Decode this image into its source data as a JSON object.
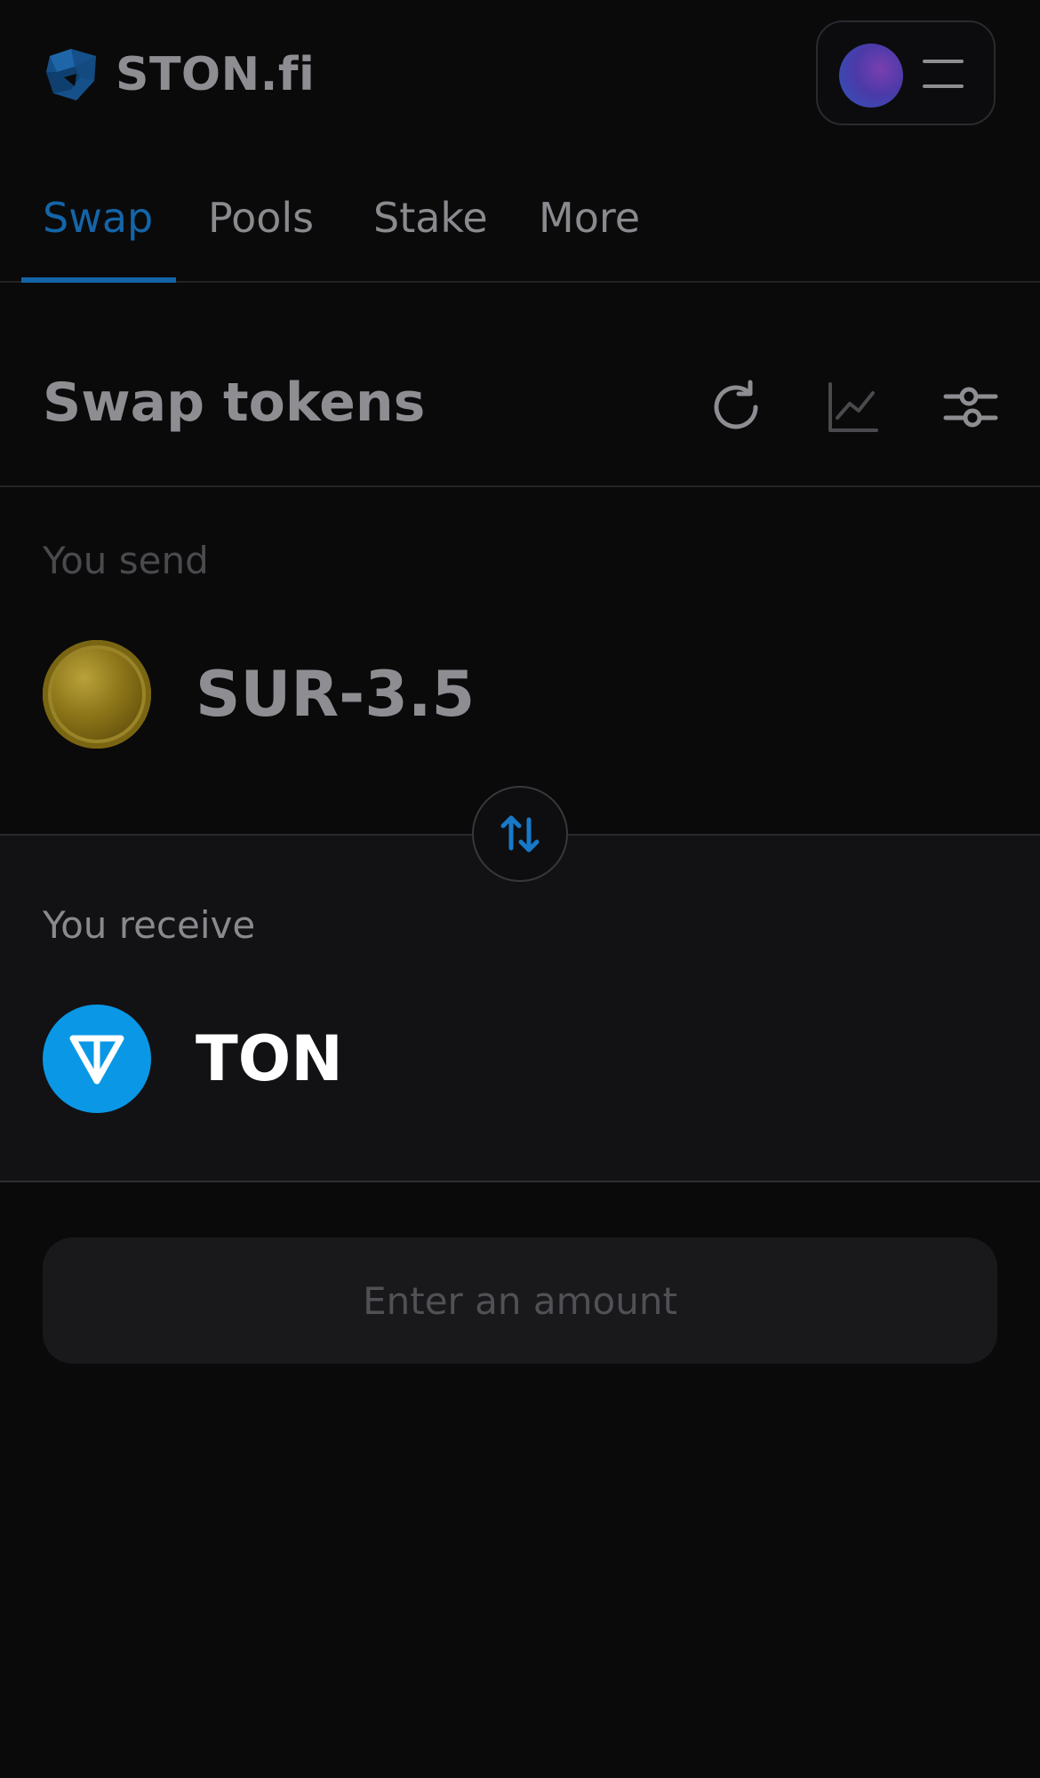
{
  "header": {
    "brand": "STON.fi",
    "logo_icon": "ston-logo-icon",
    "menu_icon": "hamburger-icon"
  },
  "tabs": [
    {
      "label": "Swap",
      "active": true
    },
    {
      "label": "Pools",
      "active": false
    },
    {
      "label": "Stake",
      "active": false
    },
    {
      "label": "More",
      "active": false
    }
  ],
  "swap": {
    "title": "Swap tokens",
    "actions": [
      "refresh-icon",
      "chart-icon",
      "settings-sliders-icon"
    ],
    "send": {
      "label": "You send",
      "token": "SUR-3.5",
      "token_icon": "gold-coin-icon"
    },
    "switch_icon": "swap-arrows-icon",
    "receive": {
      "label": "You receive",
      "token": "TON",
      "token_icon": "ton-icon"
    },
    "action_button": "Enter an amount"
  },
  "colors": {
    "accent": "#1465a8",
    "background": "#0a0a0b",
    "receive_panel": "#121215",
    "ton_blue": "#0a98e6"
  }
}
